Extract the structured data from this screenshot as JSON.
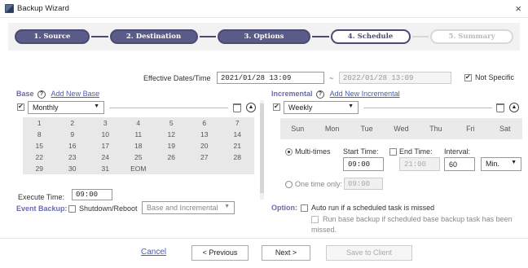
{
  "window": {
    "title": "Backup Wizard",
    "close": "×"
  },
  "steps": [
    {
      "label": "1. Source",
      "state": "done"
    },
    {
      "label": "2. Destination",
      "state": "done"
    },
    {
      "label": "3. Options",
      "state": "done"
    },
    {
      "label": "4. Schedule",
      "state": "active"
    },
    {
      "label": "5. Summary",
      "state": "future"
    }
  ],
  "effective": {
    "label": "Effective Dates/Time",
    "start": "2021/01/28 13:09",
    "separator": "~",
    "end": "2022/01/28 13:09",
    "not_specific_label": "Not Specific",
    "not_specific_checked": true
  },
  "base": {
    "title": "Base",
    "help": "?",
    "add_link": "Add New Base",
    "frequency": "Monthly",
    "days": [
      "1",
      "2",
      "3",
      "4",
      "5",
      "6",
      "7",
      "8",
      "9",
      "10",
      "11",
      "12",
      "13",
      "14",
      "15",
      "16",
      "17",
      "18",
      "19",
      "20",
      "21",
      "22",
      "23",
      "24",
      "25",
      "26",
      "27",
      "28",
      "29",
      "30",
      "31",
      "EOM"
    ],
    "execute_label": "Execute Time:",
    "execute_time": "09:00"
  },
  "incremental": {
    "title": "Incremental",
    "help": "?",
    "add_link": "Add New Incremental",
    "frequency": "Weekly",
    "weekdays": [
      "Sun",
      "Mon",
      "Tue",
      "Wed",
      "Thu",
      "Fri",
      "Sat"
    ],
    "multi_label": "Multi-times",
    "start_label": "Start Time:",
    "start_time": "09:00",
    "end_label": "End Time:",
    "end_time": "21:00",
    "interval_label": "Interval:",
    "interval_value": "60",
    "interval_unit": "Min.",
    "one_time_label": "One time only:",
    "one_time_value": "09:00"
  },
  "event_backup": {
    "label": "Event Backup:",
    "shutdown_label": "Shutdown/Reboot",
    "mode": "Base and Incremental"
  },
  "option": {
    "label": "Option:",
    "auto_run": "Auto run if a scheduled task is missed",
    "run_base_line1": "Run base backup if scheduled base backup task has been",
    "run_base_line2": "missed."
  },
  "footer": {
    "cancel": "Cancel",
    "previous": "< Previous",
    "next": "Next >",
    "save": "Save to Client"
  },
  "icons": {
    "dropdown": "▼",
    "collapse": "▲"
  }
}
